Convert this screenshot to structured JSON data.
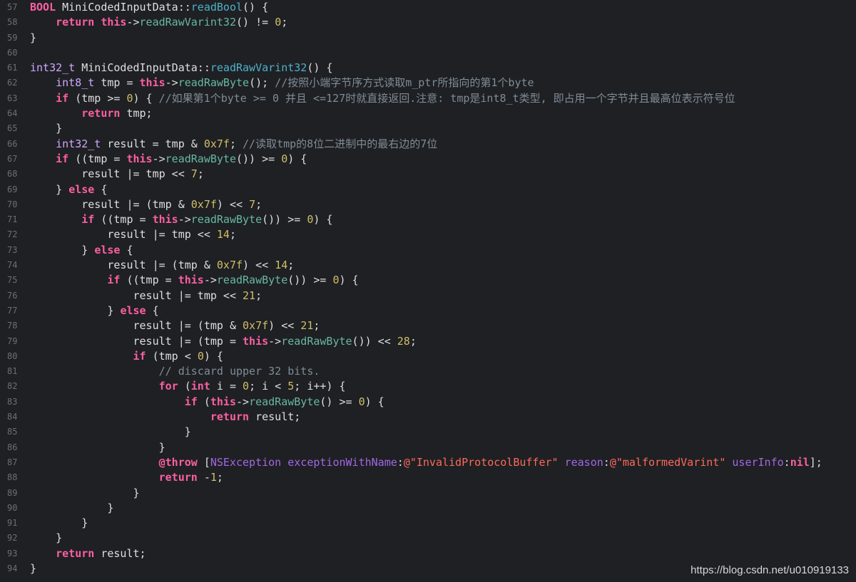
{
  "editor": {
    "watermark": "https://blog.csdn.net/u010919133",
    "lines": [
      {
        "n": "57",
        "tokens": [
          [
            "bool",
            "BOOL"
          ],
          [
            "plain",
            " "
          ],
          [
            "name",
            "MiniCodedInputData::"
          ],
          [
            "mth",
            "readBool"
          ],
          [
            "plain",
            "() {"
          ]
        ]
      },
      {
        "n": "58",
        "tokens": [
          [
            "plain",
            "    "
          ],
          [
            "kw",
            "return"
          ],
          [
            "plain",
            " "
          ],
          [
            "kw",
            "this"
          ],
          [
            "plain",
            "->"
          ],
          [
            "fn",
            "readRawVarint32"
          ],
          [
            "plain",
            "() != "
          ],
          [
            "num",
            "0"
          ],
          [
            "plain",
            ";"
          ]
        ]
      },
      {
        "n": "59",
        "tokens": [
          [
            "plain",
            "}"
          ]
        ]
      },
      {
        "n": "60",
        "tokens": []
      },
      {
        "n": "61",
        "tokens": [
          [
            "ty",
            "int32_t"
          ],
          [
            "plain",
            " MiniCodedInputData::"
          ],
          [
            "mth",
            "readRawVarint32"
          ],
          [
            "plain",
            "() {"
          ]
        ]
      },
      {
        "n": "62",
        "tokens": [
          [
            "plain",
            "    "
          ],
          [
            "ty",
            "int8_t"
          ],
          [
            "plain",
            " tmp = "
          ],
          [
            "kw",
            "this"
          ],
          [
            "plain",
            "->"
          ],
          [
            "fn",
            "readRawByte"
          ],
          [
            "plain",
            "(); "
          ],
          [
            "cmt",
            "//按照小端字节序方式读取m_ptr所指向的第1个byte"
          ]
        ]
      },
      {
        "n": "63",
        "tokens": [
          [
            "plain",
            "    "
          ],
          [
            "kw",
            "if"
          ],
          [
            "plain",
            " (tmp >= "
          ],
          [
            "num",
            "0"
          ],
          [
            "plain",
            ") { "
          ],
          [
            "cmt",
            "//如果第1个byte >= 0 并且 <=127时就直接返回.注意: tmp是int8_t类型, 即占用一个字节并且最高位表示符号位"
          ]
        ]
      },
      {
        "n": "64",
        "tokens": [
          [
            "plain",
            "        "
          ],
          [
            "kw",
            "return"
          ],
          [
            "plain",
            " tmp;"
          ]
        ]
      },
      {
        "n": "65",
        "tokens": [
          [
            "plain",
            "    }"
          ]
        ]
      },
      {
        "n": "66",
        "tokens": [
          [
            "plain",
            "    "
          ],
          [
            "ty",
            "int32_t"
          ],
          [
            "plain",
            " result = tmp & "
          ],
          [
            "num",
            "0x7f"
          ],
          [
            "plain",
            "; "
          ],
          [
            "cmt",
            "//读取tmp的8位二进制中的最右边的7位"
          ]
        ]
      },
      {
        "n": "67",
        "tokens": [
          [
            "plain",
            "    "
          ],
          [
            "kw",
            "if"
          ],
          [
            "plain",
            " ((tmp = "
          ],
          [
            "kw",
            "this"
          ],
          [
            "plain",
            "->"
          ],
          [
            "fn",
            "readRawByte"
          ],
          [
            "plain",
            "()) >= "
          ],
          [
            "num",
            "0"
          ],
          [
            "plain",
            ") {"
          ]
        ]
      },
      {
        "n": "68",
        "tokens": [
          [
            "plain",
            "        result |= tmp << "
          ],
          [
            "num",
            "7"
          ],
          [
            "plain",
            ";"
          ]
        ]
      },
      {
        "n": "69",
        "tokens": [
          [
            "plain",
            "    } "
          ],
          [
            "kw",
            "else"
          ],
          [
            "plain",
            " {"
          ]
        ]
      },
      {
        "n": "70",
        "tokens": [
          [
            "plain",
            "        result |= (tmp & "
          ],
          [
            "num",
            "0x7f"
          ],
          [
            "plain",
            ") << "
          ],
          [
            "num",
            "7"
          ],
          [
            "plain",
            ";"
          ]
        ]
      },
      {
        "n": "71",
        "tokens": [
          [
            "plain",
            "        "
          ],
          [
            "kw",
            "if"
          ],
          [
            "plain",
            " ((tmp = "
          ],
          [
            "kw",
            "this"
          ],
          [
            "plain",
            "->"
          ],
          [
            "fn",
            "readRawByte"
          ],
          [
            "plain",
            "()) >= "
          ],
          [
            "num",
            "0"
          ],
          [
            "plain",
            ") {"
          ]
        ]
      },
      {
        "n": "72",
        "tokens": [
          [
            "plain",
            "            result |= tmp << "
          ],
          [
            "num",
            "14"
          ],
          [
            "plain",
            ";"
          ]
        ]
      },
      {
        "n": "73",
        "tokens": [
          [
            "plain",
            "        } "
          ],
          [
            "kw",
            "else"
          ],
          [
            "plain",
            " {"
          ]
        ]
      },
      {
        "n": "74",
        "tokens": [
          [
            "plain",
            "            result |= (tmp & "
          ],
          [
            "num",
            "0x7f"
          ],
          [
            "plain",
            ") << "
          ],
          [
            "num",
            "14"
          ],
          [
            "plain",
            ";"
          ]
        ]
      },
      {
        "n": "75",
        "tokens": [
          [
            "plain",
            "            "
          ],
          [
            "kw",
            "if"
          ],
          [
            "plain",
            " ((tmp = "
          ],
          [
            "kw",
            "this"
          ],
          [
            "plain",
            "->"
          ],
          [
            "fn",
            "readRawByte"
          ],
          [
            "plain",
            "()) >= "
          ],
          [
            "num",
            "0"
          ],
          [
            "plain",
            ") {"
          ]
        ]
      },
      {
        "n": "76",
        "tokens": [
          [
            "plain",
            "                result |= tmp << "
          ],
          [
            "num",
            "21"
          ],
          [
            "plain",
            ";"
          ]
        ]
      },
      {
        "n": "77",
        "tokens": [
          [
            "plain",
            "            } "
          ],
          [
            "kw",
            "else"
          ],
          [
            "plain",
            " {"
          ]
        ]
      },
      {
        "n": "78",
        "tokens": [
          [
            "plain",
            "                result |= (tmp & "
          ],
          [
            "num",
            "0x7f"
          ],
          [
            "plain",
            ") << "
          ],
          [
            "num",
            "21"
          ],
          [
            "plain",
            ";"
          ]
        ]
      },
      {
        "n": "79",
        "tokens": [
          [
            "plain",
            "                result |= (tmp = "
          ],
          [
            "kw",
            "this"
          ],
          [
            "plain",
            "->"
          ],
          [
            "fn",
            "readRawByte"
          ],
          [
            "plain",
            "()) << "
          ],
          [
            "num",
            "28"
          ],
          [
            "plain",
            ";"
          ]
        ]
      },
      {
        "n": "80",
        "tokens": [
          [
            "plain",
            "                "
          ],
          [
            "kw",
            "if"
          ],
          [
            "plain",
            " (tmp < "
          ],
          [
            "num",
            "0"
          ],
          [
            "plain",
            ") {"
          ]
        ]
      },
      {
        "n": "81",
        "tokens": [
          [
            "plain",
            "                    "
          ],
          [
            "cmt",
            "// discard upper 32 bits."
          ]
        ]
      },
      {
        "n": "82",
        "tokens": [
          [
            "plain",
            "                    "
          ],
          [
            "kw",
            "for"
          ],
          [
            "plain",
            " ("
          ],
          [
            "kw",
            "int"
          ],
          [
            "plain",
            " i = "
          ],
          [
            "num",
            "0"
          ],
          [
            "plain",
            "; i < "
          ],
          [
            "num",
            "5"
          ],
          [
            "plain",
            "; i++) {"
          ]
        ]
      },
      {
        "n": "83",
        "tokens": [
          [
            "plain",
            "                        "
          ],
          [
            "kw",
            "if"
          ],
          [
            "plain",
            " ("
          ],
          [
            "kw",
            "this"
          ],
          [
            "plain",
            "->"
          ],
          [
            "fn",
            "readRawByte"
          ],
          [
            "plain",
            "() >= "
          ],
          [
            "num",
            "0"
          ],
          [
            "plain",
            ") {"
          ]
        ]
      },
      {
        "n": "84",
        "tokens": [
          [
            "plain",
            "                            "
          ],
          [
            "kw",
            "return"
          ],
          [
            "plain",
            " result;"
          ]
        ]
      },
      {
        "n": "85",
        "tokens": [
          [
            "plain",
            "                        }"
          ]
        ]
      },
      {
        "n": "86",
        "tokens": [
          [
            "plain",
            "                    }"
          ]
        ]
      },
      {
        "n": "87",
        "tokens": [
          [
            "plain",
            "                    "
          ],
          [
            "kw",
            "@throw"
          ],
          [
            "plain",
            " ["
          ],
          [
            "cls",
            "NSException"
          ],
          [
            "plain",
            " "
          ],
          [
            "cls",
            "exceptionWithName"
          ],
          [
            "plain",
            ":"
          ],
          [
            "str",
            "@\"InvalidProtocolBuffer\""
          ],
          [
            "plain",
            " "
          ],
          [
            "cls",
            "reason"
          ],
          [
            "plain",
            ":"
          ],
          [
            "str",
            "@\"malformedVarint\""
          ],
          [
            "plain",
            " "
          ],
          [
            "cls",
            "userInfo"
          ],
          [
            "plain",
            ":"
          ],
          [
            "kw",
            "nil"
          ],
          [
            "plain",
            "];"
          ]
        ]
      },
      {
        "n": "88",
        "tokens": [
          [
            "plain",
            "                    "
          ],
          [
            "kw",
            "return"
          ],
          [
            "plain",
            " -"
          ],
          [
            "num",
            "1"
          ],
          [
            "plain",
            ";"
          ]
        ]
      },
      {
        "n": "89",
        "tokens": [
          [
            "plain",
            "                }"
          ]
        ]
      },
      {
        "n": "90",
        "tokens": [
          [
            "plain",
            "            }"
          ]
        ]
      },
      {
        "n": "91",
        "tokens": [
          [
            "plain",
            "        }"
          ]
        ]
      },
      {
        "n": "92",
        "tokens": [
          [
            "plain",
            "    }"
          ]
        ]
      },
      {
        "n": "93",
        "tokens": [
          [
            "plain",
            "    "
          ],
          [
            "kw",
            "return"
          ],
          [
            "plain",
            " result;"
          ]
        ]
      },
      {
        "n": "94",
        "tokens": [
          [
            "plain",
            "}"
          ]
        ]
      }
    ]
  }
}
